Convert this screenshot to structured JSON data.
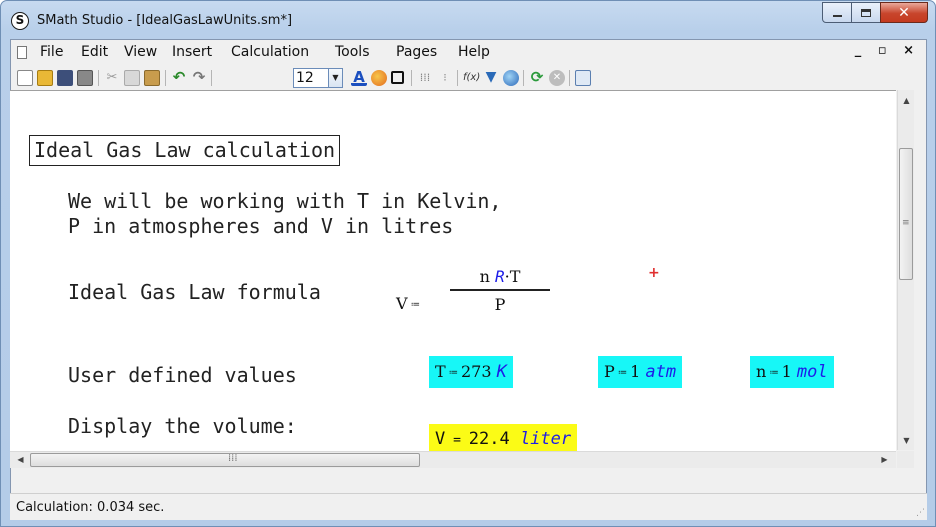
{
  "window": {
    "title": "SMath Studio - [IdealGasLawUnits.sm*]",
    "app_icon_letter": "S"
  },
  "menu": {
    "items": [
      "File",
      "Edit",
      "View",
      "Insert",
      "Calculation",
      "Tools",
      "Pages",
      "Help"
    ]
  },
  "toolbar": {
    "font_size": "12",
    "icons": [
      "new-icon",
      "open-icon",
      "save-icon",
      "print-icon",
      "cut-icon",
      "copy-icon",
      "paste-icon",
      "undo-icon",
      "redo-icon",
      "text-color-icon",
      "fill-color-icon",
      "border-icon",
      "align-icon",
      "align2-icon",
      "function-icon",
      "filter-icon",
      "dynamic-icon",
      "refresh-icon",
      "stop-icon",
      "page-icon"
    ]
  },
  "worksheet": {
    "title": "Ideal Gas Law calculation",
    "intro_line1": "We will be working with T in Kelvin,",
    "intro_line2": "P in atmospheres and V in litres",
    "formula_label": "Ideal Gas Law formula",
    "formula": {
      "lhs": "V",
      "numerator_n": "n",
      "numerator_R": "R",
      "numerator_T": "T",
      "denominator": "P"
    },
    "user_values_label": "User defined values",
    "values": [
      {
        "var": "T",
        "num": "273",
        "unit": "K"
      },
      {
        "var": "P",
        "num": "1",
        "unit": "atm"
      },
      {
        "var": "n",
        "num": "1",
        "unit": "mol"
      }
    ],
    "display_label": "Display the volume:",
    "result": {
      "var": "V",
      "num": "22.4",
      "unit": "liter"
    }
  },
  "status": {
    "text": "Calculation: 0.034 sec."
  },
  "colors": {
    "highlight_cyan": "#17f7f7",
    "highlight_yellow": "#fbfb16",
    "unit_blue": "#1d1de8"
  }
}
